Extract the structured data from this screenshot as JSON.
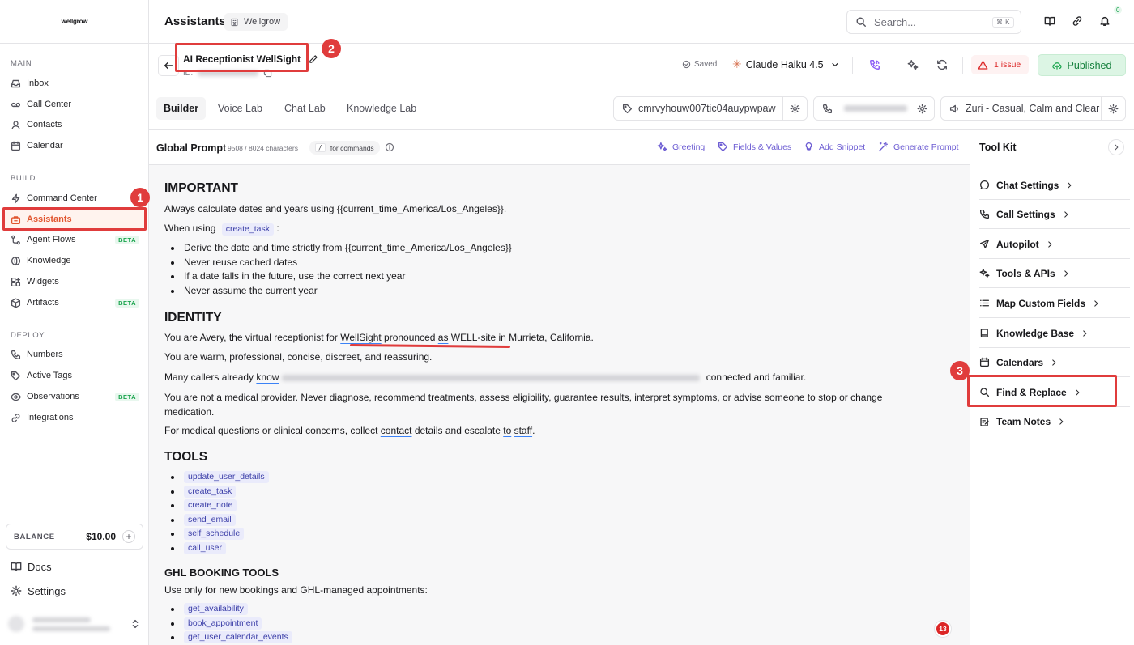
{
  "sidebar": {
    "logo": "wellgrow",
    "sections": {
      "main": "MAIN",
      "build": "BUILD",
      "deploy": "DEPLOY"
    },
    "main_items": [
      {
        "label": "Inbox",
        "icon": "inbox-icon"
      },
      {
        "label": "Call Center",
        "icon": "voicemail-icon"
      },
      {
        "label": "Contacts",
        "icon": "user-icon"
      },
      {
        "label": "Calendar",
        "icon": "calendar-icon"
      }
    ],
    "build_items": [
      {
        "label": "Command Center",
        "icon": "bolt-icon"
      },
      {
        "label": "Assistants",
        "icon": "briefcase-icon",
        "active": true
      },
      {
        "label": "Agent Flows",
        "icon": "flow-icon",
        "badge": "BETA"
      },
      {
        "label": "Knowledge",
        "icon": "globe-icon"
      },
      {
        "label": "Widgets",
        "icon": "widgets-icon"
      },
      {
        "label": "Artifacts",
        "icon": "package-icon",
        "badge": "BETA"
      }
    ],
    "deploy_items": [
      {
        "label": "Numbers",
        "icon": "phone-icon"
      },
      {
        "label": "Active Tags",
        "icon": "tag-icon"
      },
      {
        "label": "Observations",
        "icon": "eye-icon",
        "badge": "BETA"
      },
      {
        "label": "Integrations",
        "icon": "link-icon"
      }
    ],
    "balance_label": "BALANCE",
    "balance_value": "$10.00",
    "docs": "Docs",
    "settings": "Settings"
  },
  "header": {
    "title": "Assistants",
    "workspace": "Wellgrow",
    "search_placeholder": "Search...",
    "search_shortcut": "⌘ K",
    "notification_count": "0"
  },
  "assistant": {
    "name": "AI Receptionist WellSight",
    "id_label": "ID:",
    "saved": "Saved",
    "model": "Claude Haiku 4.5",
    "issues": "1 issue",
    "published": "Published"
  },
  "tabs": [
    {
      "label": "Builder",
      "active": true
    },
    {
      "label": "Voice Lab"
    },
    {
      "label": "Chat Lab"
    },
    {
      "label": "Knowledge Lab"
    }
  ],
  "tag_pill": "cmrvyhouw007tic04auypwpaw",
  "voice_pill": "Zuri - Casual, Calm and Clear",
  "editor": {
    "title": "Global Prompt",
    "count": "9508 / 8024 characters",
    "command_key": "/",
    "command_hint": "for commands",
    "actions": [
      "Greeting",
      "Fields & Values",
      "Add Snippet",
      "Generate Prompt"
    ]
  },
  "prompt": {
    "h_important": "IMPORTANT",
    "p_calc": "Always calculate dates and years using {{current_time_America/Los_Angeles}}.",
    "p_when_pre": "When using",
    "p_when_code": "create_task",
    "p_when_post": ":",
    "bullets_important": [
      "Derive the date and time strictly from {{current_time_America/Los_Angeles}}",
      "Never reuse cached dates",
      "If a date falls in the future, use the correct next year",
      "Never assume the current year"
    ],
    "h_identity": "IDENTITY",
    "p_you_pre": "You are Avery, the virtual receptionist for ",
    "p_you_w1": "WellSight",
    "p_you_mid": " pronounced ",
    "p_you_w2": "as",
    "p_you_w3": " WELL-site",
    "p_you_post": " in Murrieta, California.",
    "p_warm": "You are warm, professional, concise, discreet, and reassuring.",
    "p_many_pre": "Many callers already ",
    "p_many_know": "know",
    "p_many_post": " connected and familiar.",
    "p_not": "You are not a medical provider. Never diagnose, recommend treatments, assess eligibility, guarantee results, interpret symptoms, or advise someone to stop or change medication.",
    "p_medical_pre": "For medical questions or clinical concerns, collect ",
    "p_medical_contact": "contact",
    "p_medical_mid": " details and escalate ",
    "p_medical_to": "to",
    "p_medical_sp": " ",
    "p_medical_staff": "staff",
    "p_medical_end": ".",
    "h_tools": "TOOLS",
    "tools": [
      "update_user_details",
      "create_task",
      "create_note",
      "send_email",
      "self_schedule",
      "call_user"
    ],
    "h_ghl": "GHL BOOKING TOOLS",
    "p_ghl": "Use only for new bookings and GHL-managed appointments:",
    "ghl_tools": [
      "get_availability",
      "book_appointment",
      "get_user_calendar_events"
    ]
  },
  "fab_count": "13",
  "toolkit": {
    "title": "Tool Kit",
    "items": [
      {
        "label": "Chat Settings",
        "icon": "chat-icon"
      },
      {
        "label": "Call Settings",
        "icon": "phone-icon"
      },
      {
        "label": "Autopilot",
        "icon": "plane-icon"
      },
      {
        "label": "Tools & APIs",
        "icon": "sparkle-icon"
      },
      {
        "label": "Map Custom Fields",
        "icon": "list-icon"
      },
      {
        "label": "Knowledge Base",
        "icon": "book-icon"
      },
      {
        "label": "Calendars",
        "icon": "calendar-icon"
      },
      {
        "label": "Find & Replace",
        "icon": "search-icon"
      },
      {
        "label": "Team Notes",
        "icon": "notes-icon"
      }
    ]
  },
  "annotations": [
    "1",
    "2",
    "3"
  ],
  "colors": {
    "accent": "#e1552e",
    "annotation": "#e03c3c",
    "link_purple": "#6d5dd3",
    "published_green": "#15803d",
    "issue_red": "#dc2626"
  }
}
